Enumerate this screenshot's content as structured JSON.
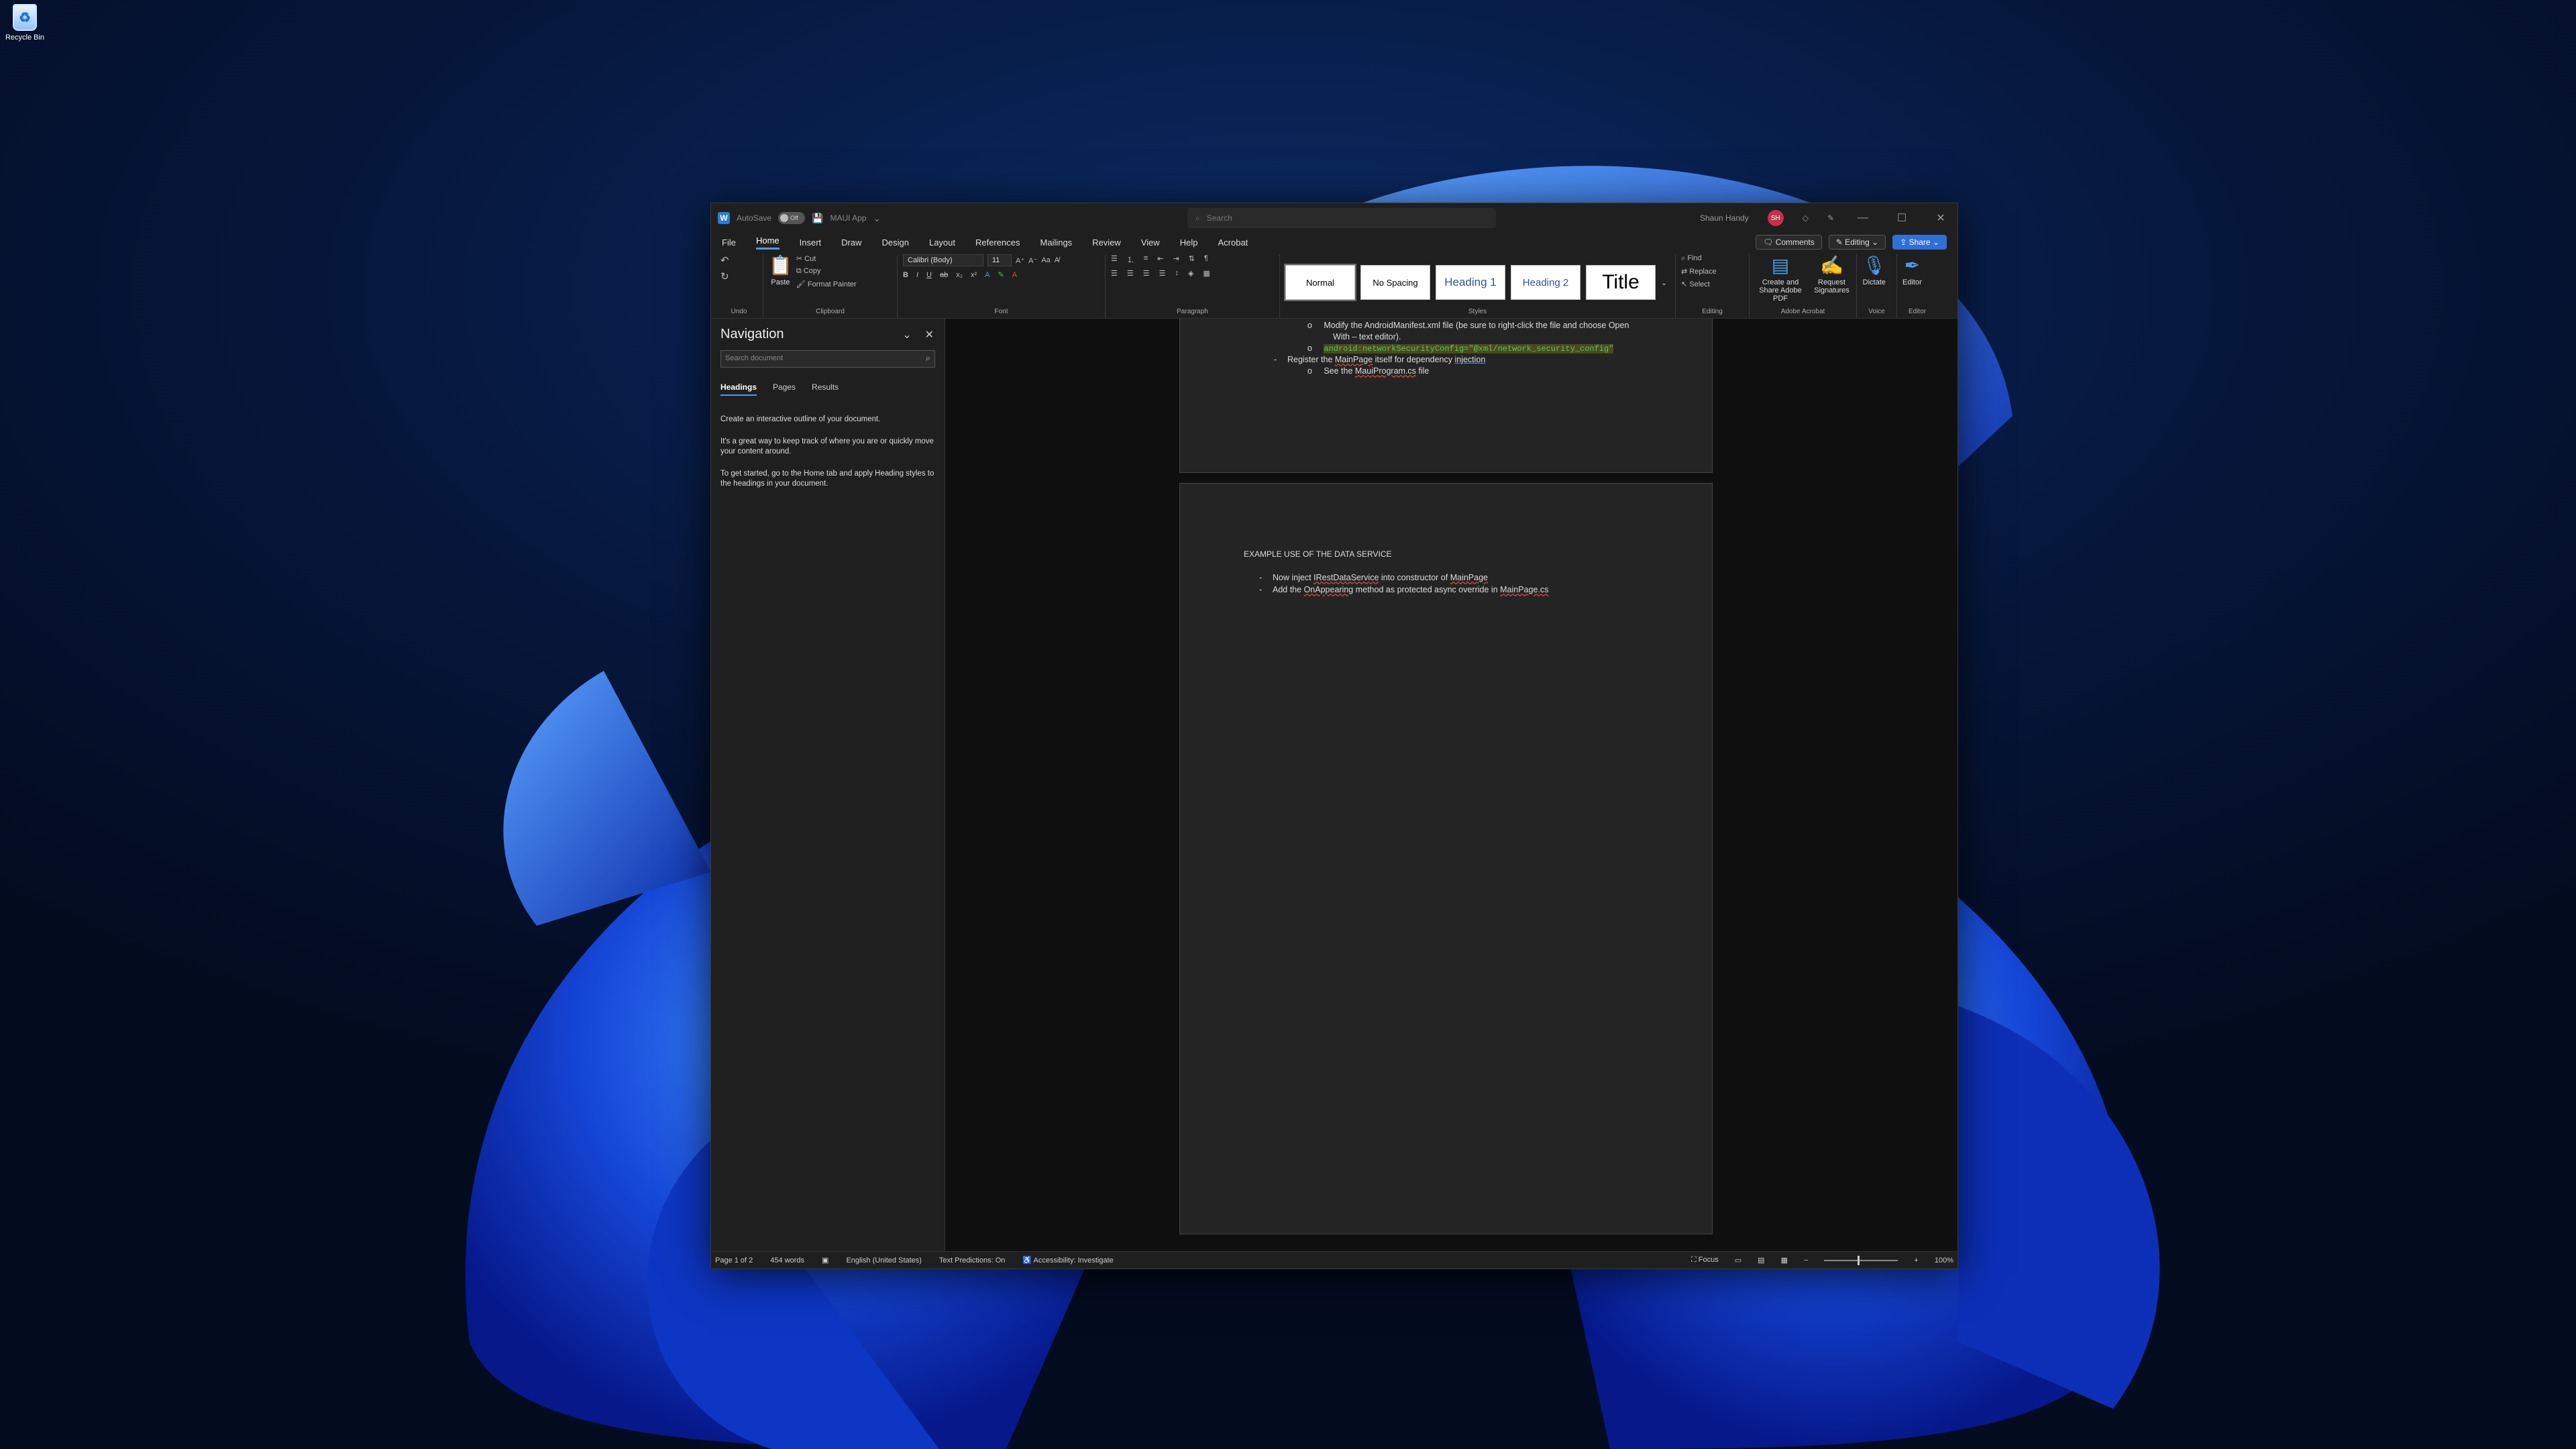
{
  "desktop": {
    "recycle_bin_label": "Recycle Bin"
  },
  "titlebar": {
    "autosave_label": "AutoSave",
    "autosave_state": "Off",
    "doc_title": "MAUI App",
    "search_placeholder": "Search",
    "user_name": "Shaun Handy",
    "user_initials": "SH"
  },
  "menubar": {
    "tabs": [
      "File",
      "Home",
      "Insert",
      "Draw",
      "Design",
      "Layout",
      "References",
      "Mailings",
      "Review",
      "View",
      "Help",
      "Acrobat"
    ],
    "active_tab": "Home",
    "comments_label": "Comments",
    "editing_label": "Editing",
    "share_label": "Share"
  },
  "ribbon": {
    "groups": {
      "undo": "Undo",
      "clipboard": "Clipboard",
      "font": "Font",
      "paragraph": "Paragraph",
      "styles": "Styles",
      "editing": "Editing",
      "adobe": "Adobe Acrobat",
      "voice": "Voice",
      "editor": "Editor"
    },
    "paste": "Paste",
    "cut": "Cut",
    "copy": "Copy",
    "format_painter": "Format Painter",
    "font_name": "Calibri (Body)",
    "font_size": "11",
    "styles": [
      "Normal",
      "No Spacing",
      "Heading 1",
      "Heading 2",
      "Title"
    ],
    "find": "Find",
    "replace": "Replace",
    "select": "Select",
    "create_share_pdf": "Create and Share Adobe PDF",
    "request_signatures": "Request Signatures",
    "dictate": "Dictate",
    "editor": "Editor"
  },
  "navigation": {
    "title": "Navigation",
    "search_placeholder": "Search document",
    "tabs": [
      "Headings",
      "Pages",
      "Results"
    ],
    "active_tab": "Headings",
    "paragraphs": [
      "Create an interactive outline of your document.",
      "It's a great way to keep track of where you are or quickly move your content around.",
      "To get started, go to the Home tab and apply Heading styles to the headings in your document."
    ]
  },
  "document": {
    "page1": {
      "line1": "Modify the AndroidManifest.xml file (be sure to right-click the file and choose Open",
      "line2": "With – text editor).",
      "highlight_code": "android:networkSecurityConfig=\"@xml/network_security_config\"",
      "register_pre": "Register the ",
      "register_link": "MainPage",
      "register_mid": " itself for dependency ",
      "register_end": "injection",
      "see_pre": "See the ",
      "see_link": "MauiProgram.cs",
      "see_end": " file"
    },
    "page2": {
      "heading": "EXAMPLE USE OF THE DATA SERVICE",
      "b1_pre": "Now inject ",
      "b1_link": "IRestDataService",
      "b1_mid": " into constructor of ",
      "b1_end": "MainPage",
      "b2_pre": "Add the ",
      "b2_link": "OnAppearing",
      "b2_mid": " method as protected async override in ",
      "b2_end": "MainPage.cs"
    }
  },
  "statusbar": {
    "page": "Page 1 of 2",
    "words": "454 words",
    "language": "English (United States)",
    "predictions": "Text Predictions: On",
    "accessibility": "Accessibility: Investigate",
    "focus": "Focus",
    "zoom": "100%"
  }
}
